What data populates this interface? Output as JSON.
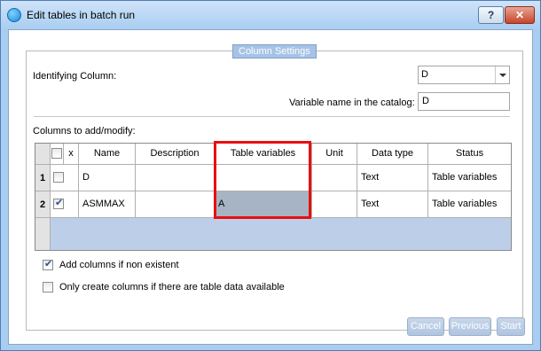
{
  "window": {
    "title": "Edit tables in batch run",
    "help_label": "?",
    "close_label": "✕"
  },
  "group": {
    "title": "Column Settings"
  },
  "identifying_column": {
    "label": "Identifying Column:",
    "value": "D"
  },
  "variable_name": {
    "label": "Variable name in the catalog:",
    "value": "D"
  },
  "columns_label": "Columns to add/modify:",
  "grid": {
    "headers": [
      "x",
      "Name",
      "Description",
      "Table variables",
      "Unit",
      "Data type",
      "Status"
    ],
    "rows": [
      {
        "num": "1",
        "checked": false,
        "name": "D",
        "description": "",
        "table_variables": "",
        "unit": "",
        "data_type": "Text",
        "status": "Table variables"
      },
      {
        "num": "2",
        "checked": true,
        "name": "ASMMAX",
        "description": "",
        "table_variables": "A",
        "unit": "",
        "data_type": "Text",
        "status": "Table variables"
      }
    ]
  },
  "options": {
    "add_columns": {
      "label": "Add columns if non existent",
      "checked": true
    },
    "only_create": {
      "label": "Only create columns if there are table data available",
      "checked": false
    }
  },
  "buttons": {
    "cancel": "Cancel",
    "previous": "Previous",
    "start": "Start"
  },
  "colors": {
    "highlight_box": "#e80f0f",
    "selected_cell": "#a7b4c4"
  }
}
